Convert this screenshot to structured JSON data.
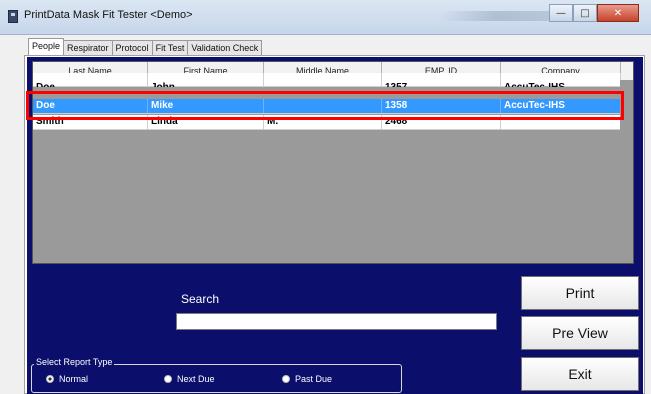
{
  "window": {
    "title": "PrintData Mask Fit Tester <Demo>",
    "minimize_icon": "minimize-icon",
    "maximize_icon": "maximize-icon",
    "close_icon": "close-icon"
  },
  "tabs": [
    {
      "label": "People",
      "active": true
    },
    {
      "label": "Respirator",
      "active": false
    },
    {
      "label": "Protocol",
      "active": false
    },
    {
      "label": "Fit Test",
      "active": false
    },
    {
      "label": "Validation Check",
      "active": false
    }
  ],
  "grid": {
    "columns": [
      "Last Name",
      "First Name",
      "Middle Name",
      "EMP. ID",
      "Company"
    ],
    "rows": [
      {
        "last": "Doe",
        "first": "John",
        "middle": "",
        "emp_id": "1357",
        "company": "AccuTec-IHS"
      },
      {
        "last": "Doe",
        "first": "Mike",
        "middle": "",
        "emp_id": "1358",
        "company": "AccuTec-IHS"
      },
      {
        "last": "Smith",
        "first": "Linda",
        "middle": "M.",
        "emp_id": "2468",
        "company": ""
      }
    ],
    "selected_row": 1,
    "selection_color": "#3399ff",
    "highlight_outline_color": "#ff0000"
  },
  "search": {
    "label": "Search",
    "value": ""
  },
  "buttons": {
    "print": "Print",
    "preview": "Pre View",
    "exit": "Exit"
  },
  "report_type": {
    "legend": "Select Report Type",
    "options": [
      {
        "label": "Normal",
        "checked": true
      },
      {
        "label": "Next Due",
        "checked": false
      },
      {
        "label": "Past Due",
        "checked": false
      }
    ]
  },
  "colors": {
    "panel_background": "#0b0f6b",
    "grid_empty_area": "#9a9a9a"
  }
}
